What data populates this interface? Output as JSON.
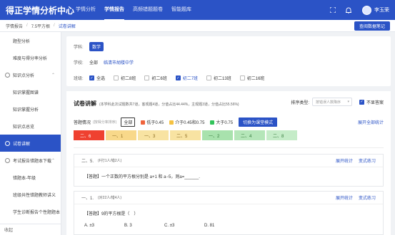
{
  "topbar": {
    "title": "得正学情分析中心",
    "nav": [
      "学情分析",
      "学情报告",
      "高频错题题卷",
      "智能题库"
    ],
    "active_nav": 1,
    "username": "李玉荣"
  },
  "breadcrumb": {
    "items": [
      "学情报告",
      "7.5平方根",
      "试卷讲解"
    ],
    "action_label": "查阅数据笔记"
  },
  "sidebar": {
    "items": [
      {
        "label": "题型分析",
        "type": "sub"
      },
      {
        "label": "难度与得分率分析",
        "type": "sub"
      },
      {
        "label": "知识点分析",
        "type": "group"
      },
      {
        "label": "知识掌握图谱",
        "type": "sub"
      },
      {
        "label": "知识掌握分析",
        "type": "sub"
      },
      {
        "label": "知识点总览",
        "type": "sub"
      },
      {
        "label": "试卷讲解",
        "type": "active"
      },
      {
        "label": "考试报告错题本下载",
        "type": "group"
      },
      {
        "label": "错题本-年级",
        "type": "sub"
      },
      {
        "label": "班级共性错题教师讲义",
        "type": "sub"
      },
      {
        "label": "学生诊断报告个性题题本",
        "type": "sub"
      }
    ],
    "footer": "收起"
  },
  "filters": {
    "subject_label": "学科:",
    "subject_value": "数学",
    "school_label": "学校:",
    "school_all": "全部",
    "school_name": "临清市胡楼中学",
    "class_label": "班级:",
    "classes": [
      {
        "label": "全选",
        "checked": true
      },
      {
        "label": "初二8班",
        "checked": false
      },
      {
        "label": "初二6班",
        "checked": false
      },
      {
        "label": "初二7班",
        "checked": true
      },
      {
        "label": "初二13班",
        "checked": false
      },
      {
        "label": "初二16班",
        "checked": false
      }
    ]
  },
  "report": {
    "title": "试卷讲解",
    "subtitle": "(本学科此次试题数共7道，客观题4道，分值占比44.44%，主观题3道，分值占比55.56%)",
    "sort_label": "排序类型:",
    "sort_placeholder": "按错误人数降序",
    "hide_label": "不显答案",
    "hide_checked": true,
    "legend_title": "答题情况",
    "legend_note": "(按得分率排序)",
    "legend_all": "全部",
    "legend": [
      {
        "label": "低于0.45",
        "color": "#f0643c"
      },
      {
        "label": "介于0.45和0.75",
        "color": "#f5c242"
      },
      {
        "label": "大于0.75",
        "color": "#32c35a"
      }
    ],
    "switch_label": "切换为课堂模式",
    "expand_all_label": "展开全部统计",
    "question_bar": [
      {
        "label": "二、6",
        "bg": "#ef4130",
        "fg": "#ffffff"
      },
      {
        "label": "一、1",
        "bg": "#f8d88a",
        "fg": "#8a6a20"
      },
      {
        "label": "一、3",
        "bg": "#f8e3a2",
        "fg": "#8a6a20"
      },
      {
        "label": "二、5",
        "bg": "#f8e3a2",
        "fg": "#8a6a20"
      },
      {
        "label": "一、2",
        "bg": "#a8e2ad",
        "fg": "#357a3c"
      },
      {
        "label": "二、4",
        "bg": "#b5e6b9",
        "fg": "#357a3c"
      },
      {
        "label": "二、8",
        "bg": "#c5ecc8",
        "fg": "#357a3c"
      }
    ],
    "questions": [
      {
        "num": "二、5.",
        "meta": "(F打1人/错2人)",
        "expand": "展开统计",
        "practice": "变式练习",
        "text": "【答题】一个正数的平方根分别是 a+1 和 a−5，则a=______.",
        "options": []
      },
      {
        "num": "一、1.",
        "meta": "(对22人/错4人)",
        "expand": "展开统计",
        "practice": "变式练习",
        "text": "【答题】9的平方根是（　）",
        "options": [
          "A. ±3",
          "B. 3",
          "C. ±3",
          "D. 81"
        ]
      }
    ]
  }
}
